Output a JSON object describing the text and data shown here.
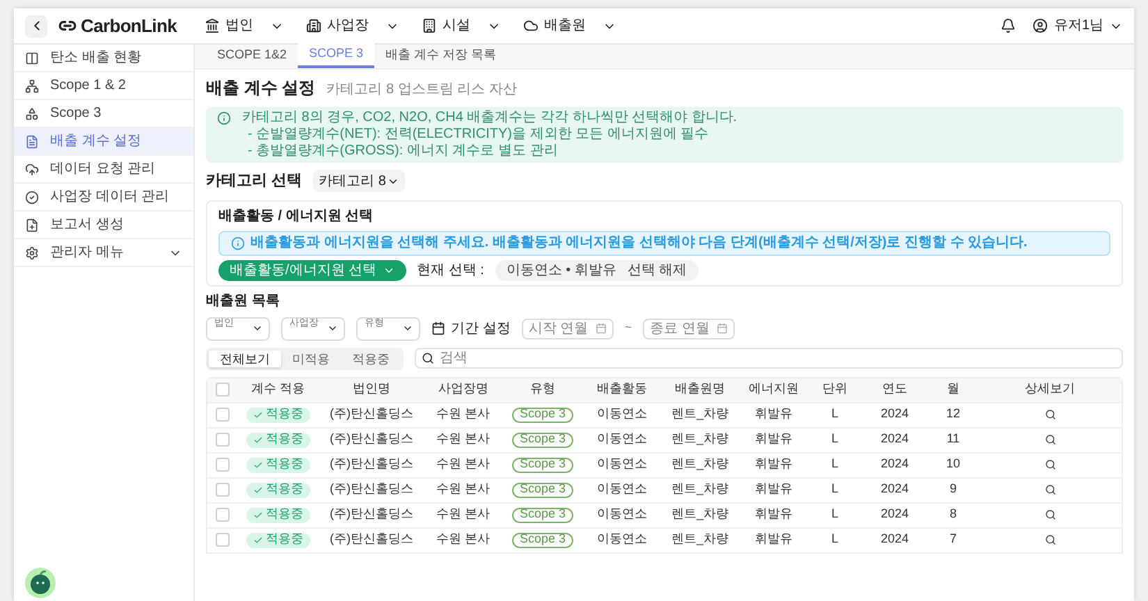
{
  "header": {
    "logo": "CarbonLink",
    "nav": [
      {
        "label": "법인"
      },
      {
        "label": "사업장"
      },
      {
        "label": "시설"
      },
      {
        "label": "배출원"
      }
    ],
    "user": "유저1님"
  },
  "sidebar": {
    "items": [
      {
        "label": "탄소 배출 현황",
        "selected": false
      },
      {
        "label": "Scope 1 & 2",
        "selected": false
      },
      {
        "label": "Scope 3",
        "selected": false
      },
      {
        "label": "배출 계수 설정",
        "selected": true
      },
      {
        "label": "데이터 요청 관리",
        "selected": false
      },
      {
        "label": "사업장 데이터 관리",
        "selected": false
      },
      {
        "label": "보고서 생성",
        "selected": false
      },
      {
        "label": "관리자 메뉴",
        "selected": false,
        "expanded": false
      }
    ]
  },
  "tabs": [
    {
      "label": "SCOPE 1&2",
      "selected": false
    },
    {
      "label": "SCOPE 3",
      "selected": true
    },
    {
      "label": "배출 계수 저장 목록",
      "selected": false
    }
  ],
  "page": {
    "title": "배출 계수 설정",
    "subtitle": "카테고리 8 업스트림 리스 자산",
    "notice": [
      "카테고리 8의 경우, CO2, N2O, CH4 배출계수는 각각 하나씩만 선택해야 합니다.",
      "- 순발열량계수(NET): 전력(ELECTRICITY)을 제외한 모든 에너지원에 필수",
      "- 총발열량계수(GROSS): 에너지 계수로 별도 관리"
    ],
    "category_label": "카테고리 선택",
    "category_value": "카테고리 8"
  },
  "selection_card": {
    "title": "배출활동 / 에너지원 선택",
    "info": "배출활동과 에너지원을 선택해 주세요. 배출활동과 에너지원을 선택해야 다음 단계(배출계수 선택/저장)로 진행할 수 있습니다.",
    "button": "배출활동/에너지원 선택",
    "current_label": "현재 선택 :",
    "current_value": "이동연소 • 휘발유",
    "clear": "선택 해제"
  },
  "source_list": {
    "title": "배출원 목록",
    "filters": [
      {
        "label": "법인"
      },
      {
        "label": "사업장"
      },
      {
        "label": "유형"
      }
    ],
    "period_label": "기간 설정",
    "start_placeholder": "시작 연월",
    "end_placeholder": "종료 연월",
    "separator": "~",
    "segments": [
      {
        "label": "전체보기",
        "selected": true
      },
      {
        "label": "미적용",
        "selected": false
      },
      {
        "label": "적용중",
        "selected": false
      }
    ],
    "search_placeholder": "검색"
  },
  "table": {
    "header_checked": false,
    "columns": [
      "계수 적용",
      "법인명",
      "사업장명",
      "유형",
      "배출활동",
      "배출원명",
      "에너지원",
      "단위",
      "연도",
      "월",
      "상세보기"
    ],
    "rows": [
      {
        "checked": false,
        "status": "적용중",
        "corp": "(주)탄신홀딩스",
        "site": "수원 본사",
        "type": "Scope 3",
        "activity": "이동연소",
        "source": "렌트_차량",
        "energy": "휘발유",
        "unit": "L",
        "year": "2024",
        "month": "12"
      },
      {
        "checked": false,
        "status": "적용중",
        "corp": "(주)탄신홀딩스",
        "site": "수원 본사",
        "type": "Scope 3",
        "activity": "이동연소",
        "source": "렌트_차량",
        "energy": "휘발유",
        "unit": "L",
        "year": "2024",
        "month": "11"
      },
      {
        "checked": false,
        "status": "적용중",
        "corp": "(주)탄신홀딩스",
        "site": "수원 본사",
        "type": "Scope 3",
        "activity": "이동연소",
        "source": "렌트_차량",
        "energy": "휘발유",
        "unit": "L",
        "year": "2024",
        "month": "10"
      },
      {
        "checked": false,
        "status": "적용중",
        "corp": "(주)탄신홀딩스",
        "site": "수원 본사",
        "type": "Scope 3",
        "activity": "이동연소",
        "source": "렌트_차량",
        "energy": "휘발유",
        "unit": "L",
        "year": "2024",
        "month": "9"
      },
      {
        "checked": false,
        "status": "적용중",
        "corp": "(주)탄신홀딩스",
        "site": "수원 본사",
        "type": "Scope 3",
        "activity": "이동연소",
        "source": "렌트_차량",
        "energy": "휘발유",
        "unit": "L",
        "year": "2024",
        "month": "8"
      },
      {
        "checked": false,
        "status": "적용중",
        "corp": "(주)탄신홀딩스",
        "site": "수원 본사",
        "type": "Scope 3",
        "activity": "이동연소",
        "source": "렌트_차량",
        "energy": "휘발유",
        "unit": "L",
        "year": "2024",
        "month": "7"
      }
    ]
  }
}
